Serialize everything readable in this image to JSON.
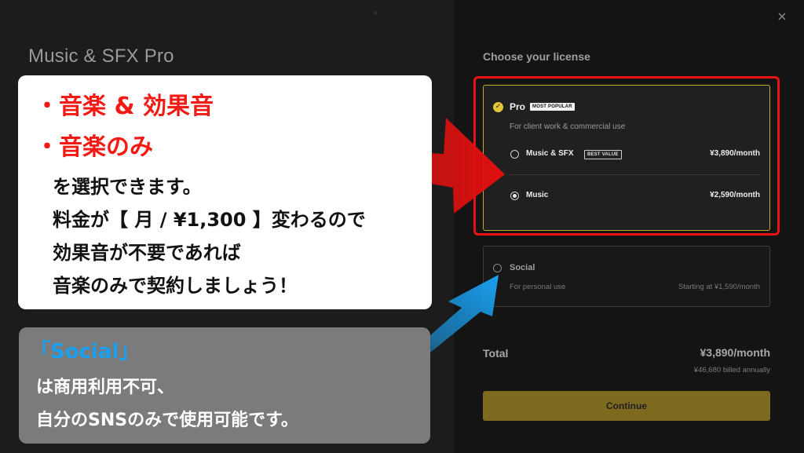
{
  "app": {
    "title": "Music & SFX Pro",
    "close_icon": "×"
  },
  "license": {
    "heading": "Choose your license",
    "pro": {
      "label": "Pro",
      "badge": "MOST POPULAR",
      "description": "For client work & commercial use",
      "options": [
        {
          "label": "Music & SFX",
          "badge": "BEST VALUE",
          "price": "¥3,890/month",
          "selected": false
        },
        {
          "label": "Music",
          "badge": "",
          "price": "¥2,590/month",
          "selected": true
        }
      ]
    },
    "social": {
      "label": "Social",
      "description": "For personal use",
      "price": "Starting at ¥1,590/month"
    },
    "total": {
      "label": "Total",
      "price": "¥3,890/month",
      "billed": "¥46,680 billed annually"
    },
    "continue_label": "Continue"
  },
  "annotation": {
    "red_lines": [
      "・音楽 & 効果音",
      "・音楽のみ"
    ],
    "black_lines": [
      "を選択できます。",
      "料金が【 月 / ¥1,300 】変わるので",
      "効果音が不要であれば",
      "音楽のみで契約しましょう！"
    ],
    "social_title": "「Social」",
    "social_lines": [
      "は商用利用不可、",
      "自分のSNSのみで使用可能です。"
    ]
  },
  "colors": {
    "highlight_red": "#e81414",
    "accent_gold": "#c3a92d",
    "button": "#7d6a1f",
    "arrow_blue": "#1aa0f0"
  }
}
